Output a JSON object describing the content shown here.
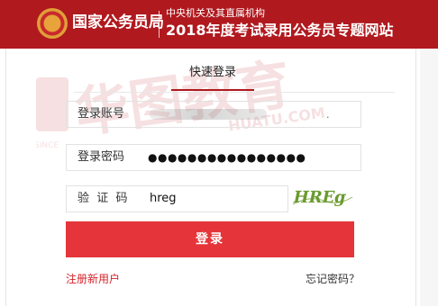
{
  "header": {
    "org_title": "国家公务员局",
    "sub_title": "中央机关及其直属机构",
    "main_title": "2018年度考试录用公务员专题网站"
  },
  "tabs": {
    "active_label": "快速登录"
  },
  "form": {
    "account_label": "登录账号",
    "account_visible_suffix": ".",
    "password_label": "登录密码",
    "password_masked": "●●●●●●●●●●●●●●●●",
    "captcha_label": "验  证  码",
    "captcha_value": "hreg",
    "captcha_image_text": "HREg"
  },
  "actions": {
    "login_label": "登录",
    "register_label": "注册新用户",
    "forgot_label": "忘记密码？"
  },
  "watermark": {
    "brand": "华图教育",
    "site": "HUATU.COM",
    "prefix": "SINCE"
  },
  "colors": {
    "header_red": "#b0191e",
    "button_red": "#e5353a",
    "link_red": "#d4232a"
  }
}
